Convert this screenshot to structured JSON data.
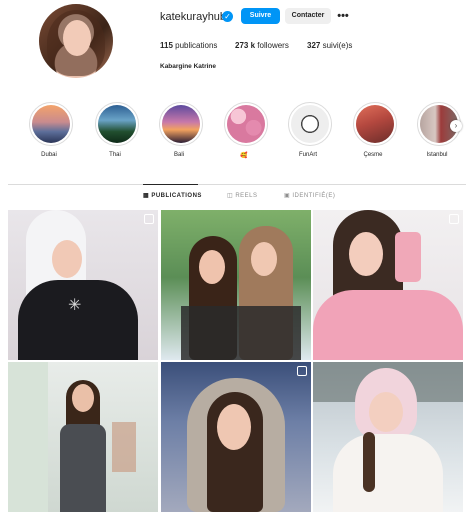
{
  "profile": {
    "username": "katekurayhub",
    "verified_icon": "verified-badge-icon",
    "follow_label": "Suivre",
    "contact_label": "Contacter",
    "more_icon": "more-options-icon",
    "more_glyph": "•••",
    "posts_count": "115",
    "posts_label": "publications",
    "followers_count": "273 k",
    "followers_label": "followers",
    "following_count": "327",
    "following_label": "suivi(e)s",
    "full_name": "Kabargine Katrine"
  },
  "highlights": [
    {
      "label": "Dubai"
    },
    {
      "label": "Thai"
    },
    {
      "label": "Bali"
    },
    {
      "label": "🥰"
    },
    {
      "label": "FunArt"
    },
    {
      "label": "Çesme"
    },
    {
      "label": "Istanbul"
    }
  ],
  "tabs": [
    {
      "label": "PUBLICATIONS",
      "active": true
    },
    {
      "label": "REELS",
      "active": false
    },
    {
      "label": "IDENTIFIÉ(E)",
      "active": false
    }
  ],
  "colors": {
    "accent": "#0095f6",
    "text": "#262626",
    "muted": "#8e8e8e",
    "border": "#dbdbdb"
  }
}
